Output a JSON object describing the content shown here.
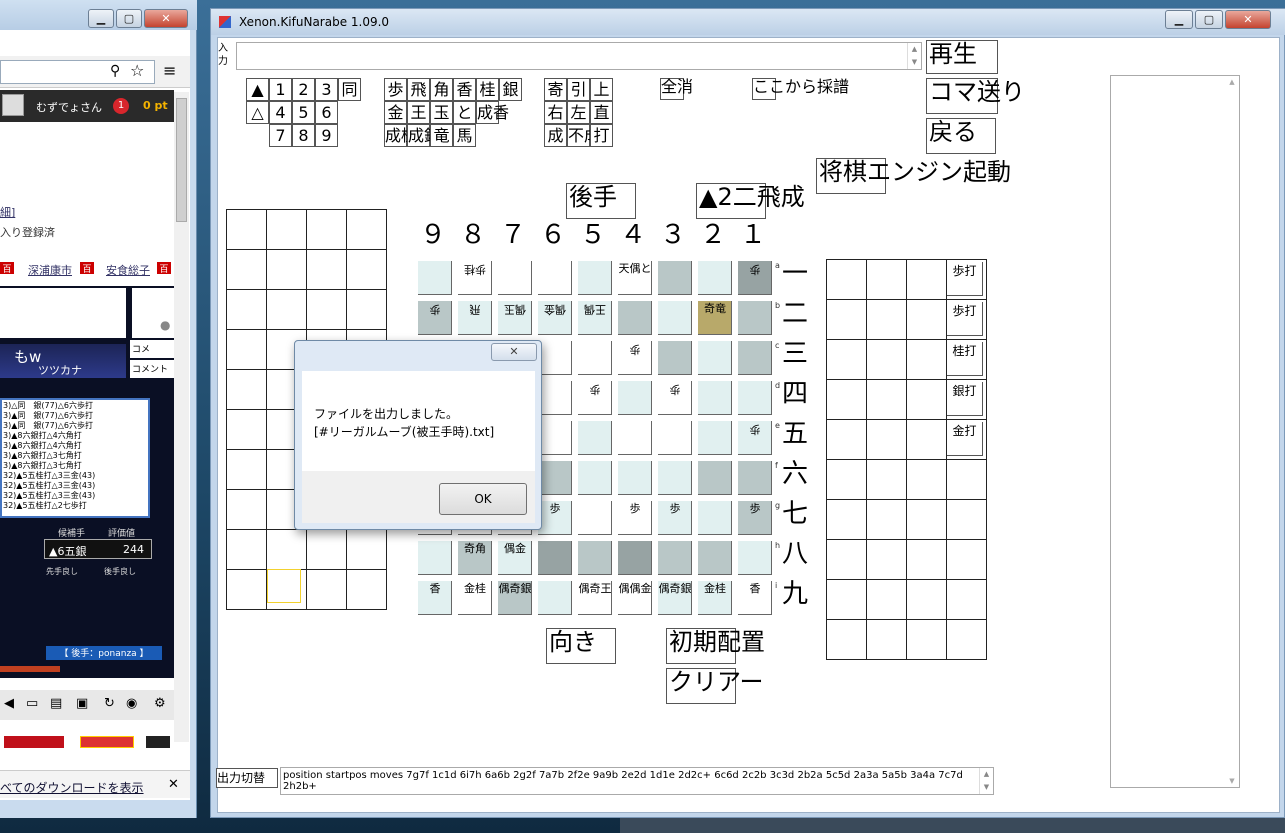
{
  "browser": {
    "user_name": "むずでょさん",
    "notice_count": "1",
    "points": "0 pt",
    "link_detail": "細]",
    "favorite_text": "入り登録済",
    "tags": [
      "深浦康市",
      "安食総子"
    ],
    "stream_text": "ツツカナ",
    "overlay_text": "もw",
    "comment_label": "コメ",
    "comment_label2": "コメント",
    "kifu_lines": [
      "3)△同　銀(77)△6六歩打",
      "3)▲同　銀(77)△6六歩打",
      "3)▲同　銀(77)△6六歩打",
      "3)▲8六銀打△4六角打",
      "3)▲8六銀打△4六角打",
      "3)▲8六銀打△3七角打",
      "3)▲8六銀打△3七角打",
      "32)▲5五桂打△3三金(43)",
      "32)▲5五桂打△3三金(43)",
      "32)▲5五桂打△3三金(43)",
      "32)▲5五桂打△2七歩打"
    ],
    "candidate_label": "候補手",
    "eval_label": "評価値",
    "candidate_move": "▲6五銀",
    "eval_value": "244",
    "sente_good": "先手良し",
    "gote_good": "後手良し",
    "gote_player": "【 後手：ponanza 】",
    "download_text": "べてのダウンロードを表示",
    "close_x": "✕"
  },
  "app": {
    "title": "Xenon.KifuNarabe 1.09.0",
    "input_label": "入力",
    "input_value": "",
    "play": "再生",
    "step": "コマ送り",
    "back": "戻る",
    "engine": "将棋エンジン起動",
    "all_clear": "全消",
    "record_from": "ここから採譜",
    "turn_label": "後手",
    "last_move": "▲2二飛成",
    "direction": "向き",
    "initial": "初期配置",
    "clear": "クリアー",
    "output_toggle": "出力切替",
    "output_text": "position startpos moves 7g7f 1c1d 6i7h 6a6b 2g2f 7a7b 2f2e 9a9b 2e2d 1d1e 2d2c+ 6c6d 2c2b 3c3d 2b2a 5c5d 2a3a 5a5b 3a4a 7c7d 2h2b+",
    "grid1": [
      "▲",
      "1",
      "2",
      "3",
      "同",
      "△",
      "4",
      "5",
      "6",
      "",
      "",
      "7",
      "8",
      "9",
      ""
    ],
    "grid2": [
      "歩",
      "飛",
      "角",
      "香",
      "桂",
      "銀",
      "金",
      "王",
      "玉",
      "と",
      "成香",
      "",
      "成桂",
      "成銀",
      "竜",
      "馬",
      ""
    ],
    "grid3": [
      "寄",
      "引",
      "上",
      "右",
      "左",
      "直",
      "成",
      "不成",
      "打"
    ],
    "files": [
      "９",
      "８",
      "７",
      "６",
      "５",
      "４",
      "３",
      "２",
      "１"
    ],
    "ranks": [
      "一",
      "二",
      "三",
      "四",
      "五",
      "六",
      "七",
      "八",
      "九"
    ],
    "rank_letters": [
      "a",
      "b",
      "c",
      "d",
      "e",
      "f",
      "g",
      "h",
      "i"
    ],
    "right_hand": [
      "歩打",
      "歩打",
      "桂打",
      "銀打",
      "金打"
    ],
    "pieces": {
      "r0c1": "歩桂",
      "r0c5": "天偶と",
      "r0c8": "歩",
      "r1c0": "歩",
      "r1c1": "飛",
      "r1c2": "偶玉",
      "r1c3": "偶金",
      "r1c4": "王偶",
      "r1c7": "奇竜",
      "r2c5": "歩",
      "r3c2": "歩",
      "r3c4": "歩",
      "r3c6": "歩",
      "r4c8": "歩",
      "r6c3": "歩",
      "r6c5": "歩",
      "r6c6": "歩",
      "r6c8": "歩",
      "r7c1": "奇角",
      "r7c2": "偶金",
      "r8c0": "香",
      "r8c1": "金桂",
      "r8c2": "偶奇銀",
      "r8c4": "偶奇王",
      "r8c5": "偶偶金",
      "r8c6": "偶奇銀",
      "r8c7": "金桂",
      "r8c8": "香"
    }
  },
  "dialog": {
    "close": "✕",
    "line1": "ファイルを出力しました。",
    "line2": "[#リーガルムーブ(被王手時).txt]",
    "ok": "OK"
  },
  "colors": {
    "highlight": "#b8a96a",
    "light": "#e1f0f0",
    "mid": "#b9c7c7",
    "dark": "#97a3a3"
  }
}
